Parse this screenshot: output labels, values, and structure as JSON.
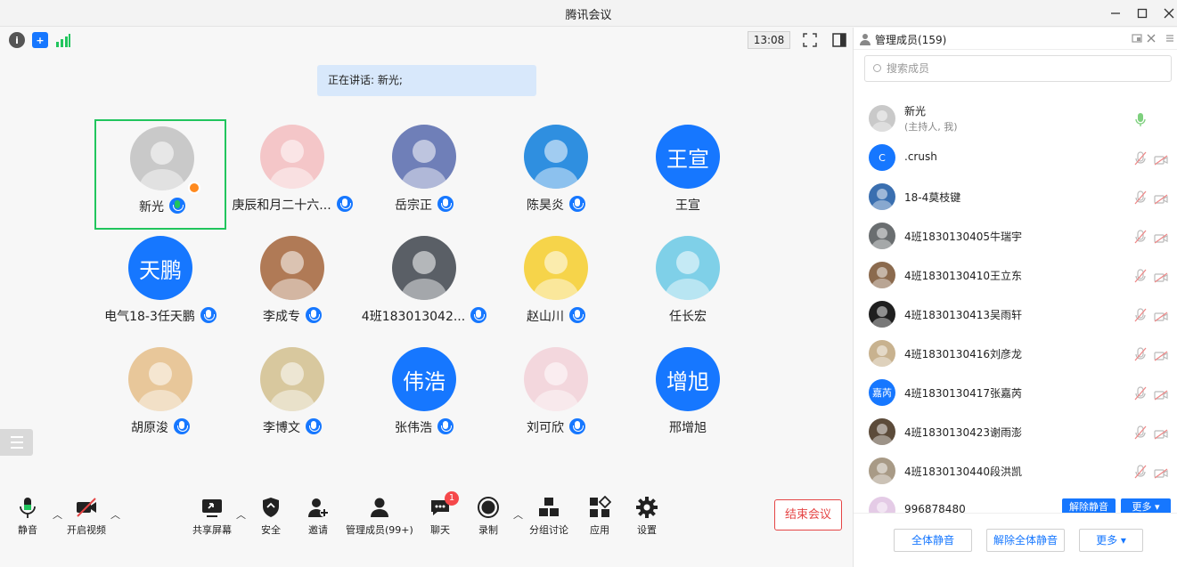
{
  "window": {
    "title": "腾讯会议"
  },
  "topbar": {
    "clock": "13:08"
  },
  "speaking": "正在讲话: 新光;",
  "participants": [
    {
      "name": "新光",
      "avatar": "photo",
      "color": "#c9c9c9"
    },
    {
      "name": "庚辰和月二十六...",
      "avatar": "photo",
      "color": "#f4c6c8"
    },
    {
      "name": "岳宗正",
      "avatar": "photo",
      "color": "#6f7fb8"
    },
    {
      "name": "陈昊炎",
      "avatar": "photo",
      "color": "#2f8fe0"
    },
    {
      "name": "王宣",
      "avatar": "王宣"
    },
    {
      "name": "电气18-3任天鹏",
      "avatar": "天鹏"
    },
    {
      "name": "李成专",
      "avatar": "photo",
      "color": "#b07a56"
    },
    {
      "name": "4班183013042...",
      "avatar": "photo",
      "color": "#5a5f66"
    },
    {
      "name": "赵山川",
      "avatar": "photo",
      "color": "#f6d44a"
    },
    {
      "name": "任长宏",
      "avatar": "photo",
      "color": "#7fd0e8"
    },
    {
      "name": "胡原浚",
      "avatar": "photo",
      "color": "#e8c79a"
    },
    {
      "name": "李博文",
      "avatar": "photo",
      "color": "#d8c89e"
    },
    {
      "name": "张伟浩",
      "avatar": "伟浩"
    },
    {
      "name": "刘可欣",
      "avatar": "photo",
      "color": "#f3d7dd"
    },
    {
      "name": "邢增旭",
      "avatar": "增旭"
    }
  ],
  "toolbar": {
    "mute": "静音",
    "video": "开启视频",
    "share": "共享屏幕",
    "security": "安全",
    "invite": "邀请",
    "members": "管理成员(99+)",
    "chat": "聊天",
    "chat_badge": "1",
    "record": "录制",
    "breakout": "分组讨论",
    "apps": "应用",
    "settings": "设置",
    "end": "结束会议"
  },
  "panel": {
    "title": "管理成员(159)",
    "search_placeholder": "搜索成员",
    "members": [
      {
        "name": "新光",
        "sub": "(主持人, 我)",
        "avatar": "photo",
        "color": "#c9c9c9"
      },
      {
        "name": ".crush",
        "avatar": "C"
      },
      {
        "name": "18-4莫枝键",
        "avatar": "photo",
        "color": "#3a6fb0"
      },
      {
        "name": "4班1830130405牛瑞宇",
        "avatar": "photo",
        "color": "#6a6e70"
      },
      {
        "name": "4班1830130410王立东",
        "avatar": "photo",
        "color": "#8b6a4e"
      },
      {
        "name": "4班1830130413吴雨轩",
        "avatar": "photo",
        "color": "#1f1f1f"
      },
      {
        "name": "4班1830130416刘彦龙",
        "avatar": "photo",
        "color": "#c8b28f"
      },
      {
        "name": "4班1830130417张嘉芮",
        "avatar": "嘉芮"
      },
      {
        "name": "4班1830130423谢雨澎",
        "avatar": "photo",
        "color": "#5c4b3a"
      },
      {
        "name": "4班1830130440段洪凯",
        "avatar": "photo",
        "color": "#a89a86"
      },
      {
        "name": "996878480",
        "avatar": "photo",
        "color": "#e4cbe6"
      }
    ],
    "row_unmute": "解除静音",
    "row_more": "更多",
    "footer": {
      "mute_all": "全体静音",
      "unmute_all": "解除全体静音",
      "more": "更多"
    }
  }
}
